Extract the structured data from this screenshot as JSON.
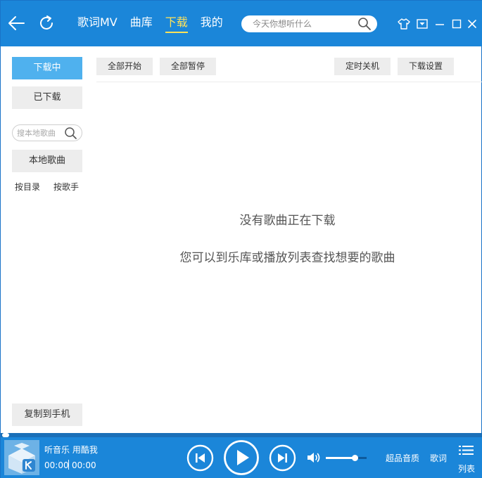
{
  "header": {
    "nav": [
      "歌词MV",
      "曲库",
      "下载",
      "我的"
    ],
    "active_nav": "下载",
    "search_placeholder": "今天你想听什么"
  },
  "sidebar": {
    "downloading_label": "下载中",
    "downloaded_label": "已下载",
    "search_placeholder": "搜本地歌曲",
    "local_songs_label": "本地歌曲",
    "by_directory_label": "按目录",
    "by_singer_label": "按歌手",
    "copy_to_phone_label": "复制到手机"
  },
  "toolbar": {
    "start_all_label": "全部开始",
    "pause_all_label": "全部暂停",
    "timer_shutdown_label": "定时关机",
    "download_settings_label": "下载设置"
  },
  "main": {
    "empty_title": "没有歌曲正在下载",
    "empty_subtitle": "您可以到乐库或播放列表查找想要的歌曲"
  },
  "player": {
    "track_title": "听音乐 用酷我",
    "current_time": "00:00",
    "total_time": "00:00",
    "volume_fraction": 0.72,
    "quality_label": "超品音质",
    "lyrics_label": "歌词",
    "playlist_label": "列表"
  },
  "colors": {
    "accent": "#1b86d9",
    "active_nav": "#ffe25a",
    "active_side": "#4fb1ee"
  }
}
